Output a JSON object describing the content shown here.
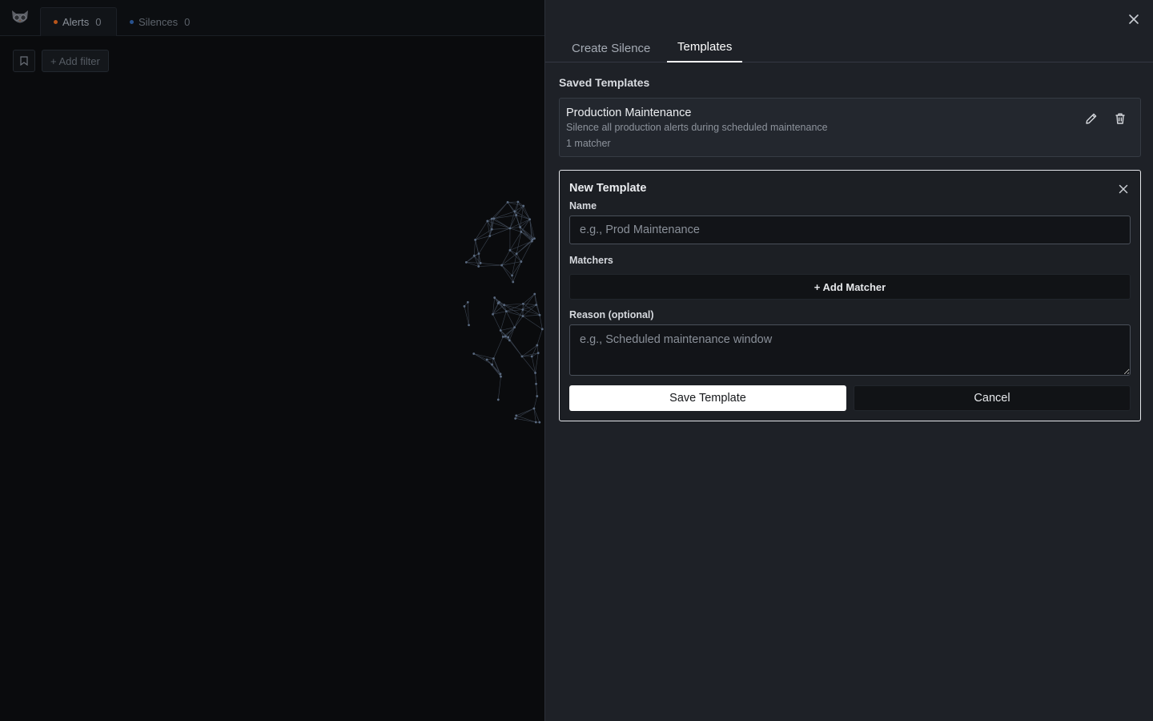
{
  "app": {
    "tabs": [
      {
        "label": "Alerts",
        "count": "0",
        "dot_color": "#e36a1c"
      },
      {
        "label": "Silences",
        "count": "0",
        "dot_color": "#2f6fd1"
      }
    ],
    "filter": {
      "bookmark_icon": "bookmark-icon",
      "add_filter_label": "+ Add filter"
    }
  },
  "panel": {
    "close_icon": "close-icon",
    "tabs": [
      {
        "label": "Create Silence",
        "active": false
      },
      {
        "label": "Templates",
        "active": true
      }
    ],
    "saved_section_title": "Saved Templates",
    "saved_templates": [
      {
        "name": "Production Maintenance",
        "description": "Silence all production alerts during scheduled maintenance",
        "meta": "1 matcher",
        "edit_icon": "pencil-icon",
        "delete_icon": "trash-icon"
      }
    ],
    "new_template": {
      "title": "New Template",
      "name_label": "Name",
      "name_placeholder": "e.g., Prod Maintenance",
      "name_value": "",
      "matchers_label": "Matchers",
      "add_matcher_label": "+ Add Matcher",
      "reason_label": "Reason (optional)",
      "reason_placeholder": "e.g., Scheduled maintenance window",
      "reason_value": "",
      "save_label": "Save Template",
      "cancel_label": "Cancel"
    }
  },
  "colors": {
    "panel_bg": "#1e2127",
    "accent_white": "#ffffff",
    "alerts_dot": "#e36a1c",
    "silences_dot": "#2f6fd1"
  }
}
